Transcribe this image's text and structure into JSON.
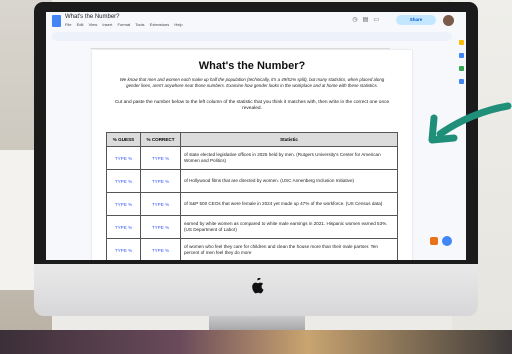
{
  "doc": {
    "window_title": "What's the Number?",
    "menu_items": [
      "File",
      "Edit",
      "View",
      "Insert",
      "Format",
      "Tools",
      "Extensions",
      "Help"
    ],
    "share_label": "Share",
    "title": "What's the Number?",
    "intro": "We know that men and women each make up half the population (technically, it's a 49/51% split), but many statistics, when placed along gender lines, aren't anywhere near those numbers. Examine how gender looks in the workplace and at home with these statistics.",
    "instructions": "Cut and paste the number below to the left column of the statistic that you think it matches with, then write in the correct one once revealed."
  },
  "table": {
    "headers": [
      "% GUESS",
      "% CORRECT",
      "Statistic"
    ],
    "rows": [
      {
        "guess": "TYPE %",
        "correct": "TYPE %",
        "statistic": "of state elected legislative offices in 2025 held by men. (Rutgers University's Center for American Women and Politics)"
      },
      {
        "guess": "TYPE %",
        "correct": "TYPE %",
        "statistic": "of Hollywood films that are directed by women. (USC Annenberg Inclusion Initiative)"
      },
      {
        "guess": "TYPE %",
        "correct": "TYPE %",
        "statistic": "of S&P 500 CEOs that were female in 2024 yet made up 47% of the workforce. (US Census data)"
      },
      {
        "guess": "TYPE %",
        "correct": "TYPE %",
        "statistic": "earned by white women as compared to white male earnings in 2021. Hispanic women earned 53%. (US Department of Labor)"
      },
      {
        "guess": "TYPE %",
        "correct": "TYPE %",
        "statistic": "of women who feel they care for children and clean the house more than their male partner. Ten percent of men feel they do more"
      }
    ]
  },
  "colors": {
    "arrow": "#1f8f7a",
    "type_text": "#3d5afe",
    "share_bg": "#c2e7ff"
  }
}
